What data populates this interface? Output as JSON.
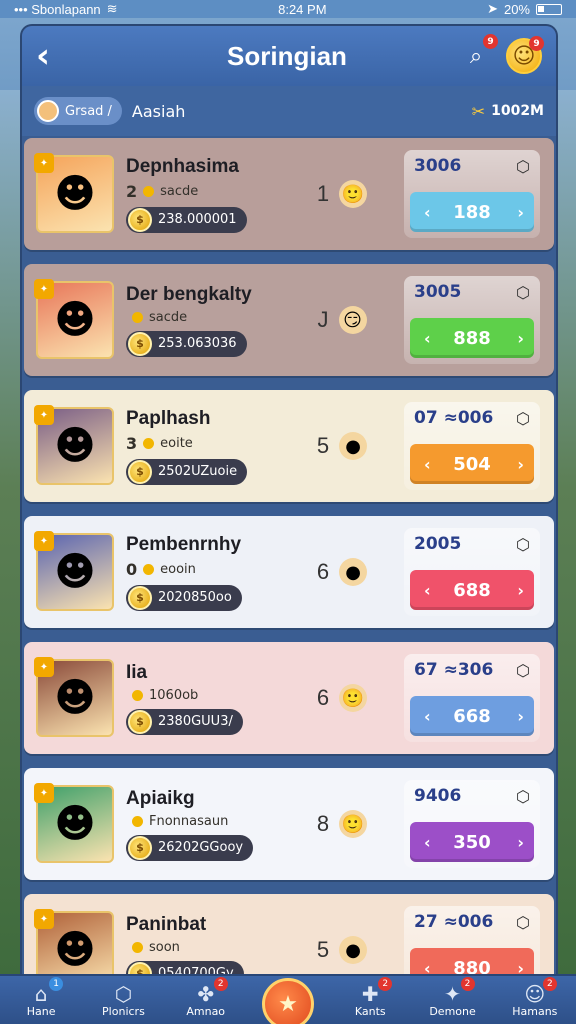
{
  "status_bar": {
    "carrier": "••• Sbonlapann",
    "time": "8:24 PM",
    "battery": "20%"
  },
  "header": {
    "title": "Soringian",
    "search_badge": "9",
    "profile_badge": "9"
  },
  "subbar": {
    "search_pill_label": "Grsad /",
    "label": "Aasiah",
    "currency_value": "1002M"
  },
  "players": [
    {
      "name": "Depnhasima",
      "level": "2",
      "stat_text": "sacde",
      "score": "238.000001",
      "rank": "1",
      "action_label": "3006",
      "action_value": "188",
      "row_color": "#b89e9a",
      "action_btn_color": "#6cc7e8",
      "avatar_color": "#f5a45b",
      "emoji": "🙂"
    },
    {
      "name": "Der bengkalty",
      "level": "",
      "stat_text": "sacde",
      "score": "253.063036",
      "rank": "J",
      "action_label": "3005",
      "action_value": "888",
      "row_color": "#b8a09c",
      "action_btn_color": "#5ed04a",
      "avatar_color": "#e8775a",
      "emoji": "😏"
    },
    {
      "name": "Paplhash",
      "level": "3",
      "stat_text": "eoite",
      "score": "2502UZuoie",
      "rank": "5",
      "action_label": "07 ≈006",
      "action_value": "504",
      "row_color": "#f3ecd8",
      "action_btn_color": "#f59a2e",
      "avatar_color": "#7a5e86",
      "emoji": "●"
    },
    {
      "name": "Pembenrnhy",
      "level": "0",
      "stat_text": "eooin",
      "score": "2020850oo",
      "rank": "6",
      "action_label": "2005",
      "action_value": "688",
      "row_color": "#eef1f7",
      "action_btn_color": "#f0526a",
      "avatar_color": "#5a64b0",
      "emoji": "●"
    },
    {
      "name": "Iia",
      "level": "",
      "stat_text": "1060ob",
      "score": "2380GUU3/",
      "rank": "6",
      "action_label": "67 ≈306",
      "action_value": "668",
      "row_color": "#f4d9d9",
      "action_btn_color": "#6e9ee0",
      "avatar_color": "#8a4a3a",
      "emoji": "🙂"
    },
    {
      "name": "Apiaikg",
      "level": "",
      "stat_text": "Fnonnasaun",
      "score": "26202GGooy",
      "rank": "8",
      "action_label": "9406",
      "action_value": "350",
      "row_color": "#f3f5fa",
      "action_btn_color": "#9c4fc8",
      "avatar_color": "#3fa06a",
      "emoji": "🙂"
    },
    {
      "name": "Paninbat",
      "level": "",
      "stat_text": "soon",
      "score": "0540700Gy",
      "rank": "5",
      "action_label": "27 ≈006",
      "action_value": "880",
      "row_color": "#f4e2d2",
      "action_btn_color": "#f06a5a",
      "avatar_color": "#b0623a",
      "emoji": "●"
    }
  ],
  "bottom_nav": [
    {
      "label": "Hane",
      "icon": "home-icon",
      "glyph": "⌂",
      "badge": "1",
      "badge_color": "blue"
    },
    {
      "label": "Plonicrs",
      "icon": "shield-icon",
      "glyph": "⬡",
      "badge": "",
      "badge_color": ""
    },
    {
      "label": "Amnao",
      "icon": "puzzle-icon",
      "glyph": "✤",
      "badge": "2",
      "badge_color": "red"
    },
    {
      "label": "",
      "icon": "center-play-icon",
      "glyph": "★",
      "badge": "",
      "badge_color": ""
    },
    {
      "label": "Kants",
      "icon": "game-icon",
      "glyph": "✚",
      "badge": "2",
      "badge_color": "red"
    },
    {
      "label": "Demone",
      "icon": "compass-icon",
      "glyph": "✦",
      "badge": "2",
      "badge_color": "red"
    },
    {
      "label": "Hamans",
      "icon": "user-icon",
      "glyph": "☺",
      "badge": "2",
      "badge_color": "red"
    }
  ]
}
